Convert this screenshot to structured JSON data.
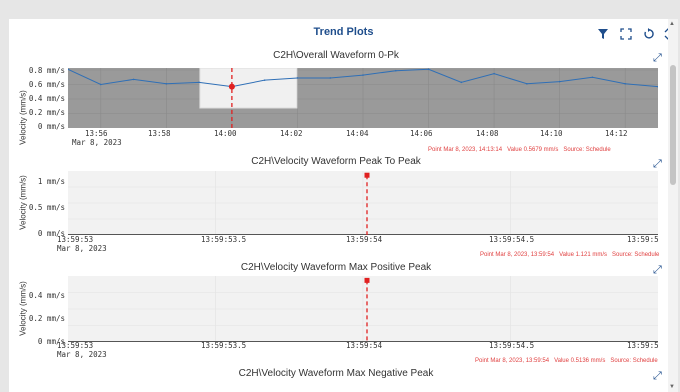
{
  "header": {
    "title": "Trend Plots"
  },
  "toolbar": {
    "filter_icon": "filter-icon",
    "fullscreen_icon": "fullscreen-icon",
    "reset_icon": "reset-icon",
    "sort_icon": "expand-collapse-icon"
  },
  "colors": {
    "accent": "#1f4e8c",
    "cursor": "#e02020",
    "line": "#2f6fb6",
    "plot_bg_dark": "#9a9a9a",
    "plot_bg_light": "#f2f2f2"
  },
  "charts": [
    {
      "title": "C2H\\Overall Waveform 0-Pk",
      "ylabel": "Velocity (mm/s)",
      "yticks": [
        "0.8 mm/s",
        "0.6 mm/s",
        "0.4 mm/s",
        "0.2 mm/s",
        "0 mm/s"
      ],
      "xticks": [
        "13:56",
        "13:58",
        "14:00",
        "14:02",
        "14:04",
        "14:06",
        "14:08",
        "14:10",
        "14:12"
      ],
      "xdate": "Mar 8, 2023",
      "info": {
        "point": "Point Mar 8, 2023, 14:13:14",
        "value": "Value 0.5679 mm/s",
        "source": "Source: Schedule"
      }
    },
    {
      "title": "C2H\\Velocity Waveform Peak To Peak",
      "ylabel": "Velocity (mm/s)",
      "yticks": [
        "1 mm/s",
        "0.5 mm/s",
        "0 mm/s"
      ],
      "xticks": [
        "13:59:53",
        "13:59:53.5",
        "13:59:54",
        "13:59:54.5",
        "13:59:5"
      ],
      "xdate": "Mar 8, 2023",
      "info": {
        "point": "Point Mar 8, 2023, 13:59:54",
        "value": "Value 1.121 mm/s",
        "source": "Source: Schedule"
      }
    },
    {
      "title": "C2H\\Velocity Waveform Max Positive Peak",
      "ylabel": "Velocity (mm/s)",
      "yticks": [
        "0.4 mm/s",
        "0.2 mm/s",
        "0 mm/s"
      ],
      "xticks": [
        "13:59:53",
        "13:59:53.5",
        "13:59:54",
        "13:59:54.5",
        "13:59:5"
      ],
      "xdate": "Mar 8, 2023",
      "info": {
        "point": "Point Mar 8, 2023, 13:59:54",
        "value": "Value 0.5136 mm/s",
        "source": "Source: Schedule"
      }
    },
    {
      "title": "C2H\\Velocity Waveform Max Negative Peak"
    }
  ],
  "chart_data": [
    {
      "type": "line",
      "title": "C2H\\Overall Waveform 0-Pk",
      "ylabel": "Velocity (mm/s)",
      "ylim": [
        0,
        0.8
      ],
      "x": [
        "13:55",
        "13:56",
        "13:57",
        "13:58",
        "13:59",
        "14:00",
        "14:01",
        "14:02",
        "14:03",
        "14:04",
        "14:05",
        "14:06",
        "14:07",
        "14:08",
        "14:09",
        "14:10",
        "14:11",
        "14:12",
        "14:13"
      ],
      "values": [
        0.81,
        0.6,
        0.67,
        0.61,
        0.63,
        0.57,
        0.66,
        0.69,
        0.69,
        0.73,
        0.79,
        0.81,
        0.63,
        0.75,
        0.61,
        0.64,
        0.7,
        0.61,
        0.57
      ],
      "selected": {
        "x": "14:00",
        "y": 0.57
      }
    },
    {
      "type": "scatter",
      "title": "C2H\\Velocity Waveform Peak To Peak",
      "ylabel": "Velocity (mm/s)",
      "ylim": [
        0,
        1.2
      ],
      "points": [
        {
          "x": "13:59:54",
          "y": 1.121
        }
      ]
    },
    {
      "type": "scatter",
      "title": "C2H\\Velocity Waveform Max Positive Peak",
      "ylabel": "Velocity (mm/s)",
      "ylim": [
        0,
        0.55
      ],
      "points": [
        {
          "x": "13:59:54",
          "y": 0.5136
        }
      ]
    }
  ]
}
